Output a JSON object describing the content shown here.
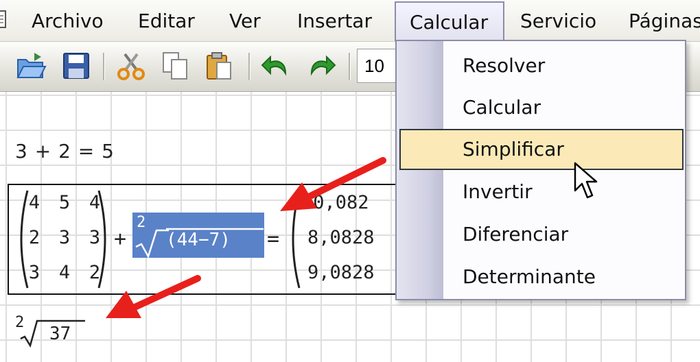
{
  "menubar": {
    "items": [
      {
        "label": "Archivo"
      },
      {
        "label": "Editar"
      },
      {
        "label": "Ver"
      },
      {
        "label": "Insertar"
      },
      {
        "label": "Calcular"
      },
      {
        "label": "Servicio"
      },
      {
        "label": "Páginas"
      }
    ]
  },
  "toolbar": {
    "icons": [
      "open-icon",
      "save-icon",
      "cut-icon",
      "copy-icon",
      "paste-icon",
      "undo-icon",
      "redo-icon"
    ],
    "font_size": "10"
  },
  "worksheet": {
    "expr1": "3 + 2 = 5",
    "matrix": [
      [
        "4",
        "5",
        "4"
      ],
      [
        "2",
        "3",
        "3"
      ],
      [
        "3",
        "4",
        "2"
      ]
    ],
    "plus": "+",
    "root_index": "2",
    "root_content": "(44−7)",
    "equals": "=",
    "result_partial": [
      "10,082",
      "8,0828",
      "9,0828"
    ],
    "result_root_index": "2",
    "result_root_content": "37"
  },
  "dropdown": {
    "items": [
      {
        "label": "Resolver"
      },
      {
        "label": "Calcular"
      },
      {
        "label": "Simplificar",
        "highlighted": true
      },
      {
        "label": "Invertir"
      },
      {
        "label": "Diferenciar"
      },
      {
        "label": "Determinante"
      }
    ]
  },
  "colors": {
    "highlight": "#fbeab7",
    "selection": "#5a82c8",
    "annotation_arrow": "#e8201c"
  }
}
